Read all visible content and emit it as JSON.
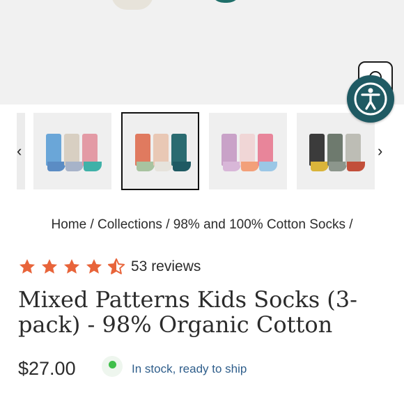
{
  "breadcrumb": {
    "items": [
      "Home",
      "Collections",
      "98% and 100% Cotton Socks"
    ],
    "separator": "/"
  },
  "rating": {
    "value": 4.5,
    "max": 5,
    "reviews_label": "53 reviews",
    "star_color": "#e8643a"
  },
  "product": {
    "title": "Mixed Patterns Kids Socks (3-pack) - 98% Organic Cotton",
    "price": "$27.00",
    "stock_text": "In stock, ready to ship",
    "stock_color": "#3fbf4a"
  },
  "gallery": {
    "selected_index": 1,
    "thumbnails": [
      "thumbnail-1",
      "thumbnail-2",
      "thumbnail-3",
      "thumbnail-4"
    ],
    "prev_icon": "chevron-left-icon",
    "next_icon": "chevron-right-icon"
  },
  "icons": {
    "zoom": "zoom-icon",
    "accessibility": "accessibility-icon"
  },
  "colors": {
    "accessibility_bg": "#1f5a63",
    "text": "#2b2b2b",
    "stock_text": "#2f5e8b"
  }
}
